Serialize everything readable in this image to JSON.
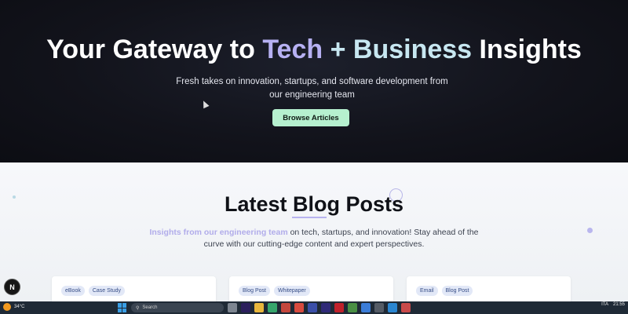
{
  "hero": {
    "title_prefix": "Your Gateway to ",
    "title_accent1": "Tech",
    "title_plus": " + ",
    "title_accent2": "Business",
    "title_suffix": " Insights",
    "subtitle": "Fresh takes on innovation, startups, and software development from our engineering team",
    "button_label": "Browse Articles"
  },
  "blog": {
    "title": "Latest Blog Posts",
    "desc_highlight": "Insights from our engineering team",
    "desc_rest": " on tech, startups, and innovation! Stay ahead of the curve with our cutting-edge content and expert perspectives.",
    "cards": [
      {
        "tags": [
          "eBook",
          "Case Study"
        ]
      },
      {
        "tags": [
          "Blog Post",
          "Whitepaper"
        ]
      },
      {
        "tags": [
          "Email",
          "Blog Post"
        ]
      }
    ]
  },
  "floating_button": {
    "label": "N"
  },
  "taskbar": {
    "temperature": "34°C",
    "search_placeholder": "Search",
    "language": "ITA",
    "time": "21:55"
  },
  "colors": {
    "accent_purple": "#b7b1f3",
    "accent_cyan": "#c7e7f1",
    "button_green": "#b6f0cf",
    "hero_bg": "#12131b"
  }
}
